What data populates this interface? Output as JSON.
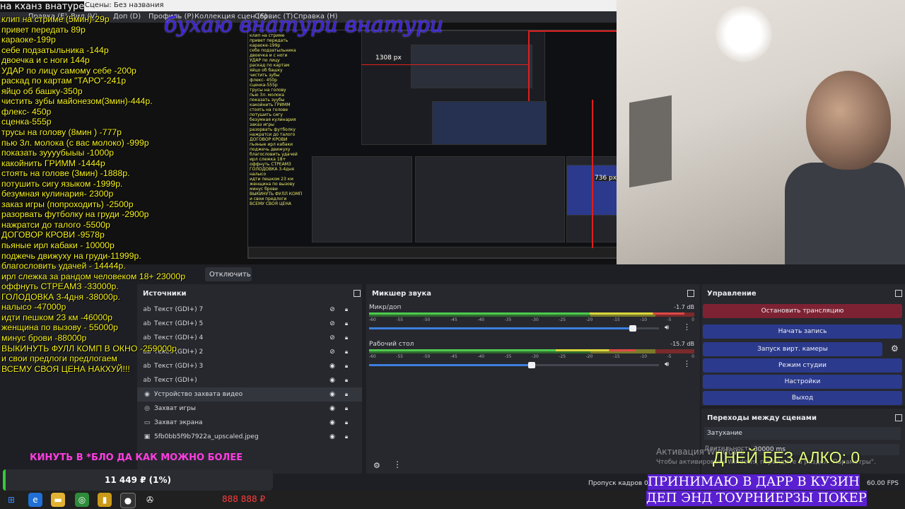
{
  "window": {
    "title": "Сцены: Без названия",
    "caption": "на кханз внатуре"
  },
  "menu": {
    "items": [
      "Правка (E)",
      "Вид (V)",
      "Доп (D)",
      "Профиль (P)",
      "Коллекция сцен (S)",
      "Сервис (T)",
      "Справка (H)"
    ]
  },
  "overlay": {
    "title": "бухаю внатури внатури",
    "donation_goal": "КИНУТЬ В *БЛО ДА КАК МОЖНО БОЛЕЕ",
    "donation_amount": "11 449 ₽ (1%)",
    "money_counter": "888 888 ₽",
    "sober_counter": "ДНЕЙ БЕЗ АЛКО: 0",
    "accept_line1": "ПРИНИМАЮ В ДАРР В КУЗИН",
    "accept_line2": "ДЕП ЭНД ТОУРНИЕРЗЫ ПОКЕР",
    "nested_px_1": "1308 px",
    "nested_px_2": "736 px"
  },
  "price_list": [
    "клип на стриме (5мин)-29р",
    "привет передать 89р",
    "караоке-199р",
    "себе подзатыльника -144р",
    "двоечка и с ноги 144р",
    "УДАР по лицу самому себе -200р",
    "раскад по картам \"ТАРО\"-241р",
    "яйцо об башку-350р",
    "чистить зубы майонезом(3мин)-444р.",
    "флекс- 450р",
    "сценка-555р",
    "трусы на голову (8мин ) -777р",
    "пью 3л. молока (с вас молоко) -999р",
    "показать зуууубыыы -1000р",
    "какойнить ГРИММ -1444р",
    "стоять на голове (3мин) -1888р.",
    "потушить сигу языком -1999р.",
    "безумная кулинария- 2300р",
    "заказ игры (попроходить) -2500р",
    "разорвать футболку на груди -2900р",
    "нажратси до талого -5500р",
    "ДОГОВОР КРОВИ -9578р",
    "пьяные ирл кабаки - 10000р",
    "поджечь движуху на груди-11999р.",
    "благословить удачей - 14444р.",
    "ирл слежка за рандом человеком 18+ 23000р",
    "оффнуть СТРЕАМЗ -33000р.",
    "ГОЛОДОВКА 3-4дня -38000р.",
    "налысо -47000р",
    "идти пешком 23 км -46000р",
    "женщина по вызову - 55000р",
    "минус брови -88000р",
    "ВЫКИНУТЬ ФУЛЛ КОМП В ОКНО -259000р",
    "и свои предлоги предлогаем",
    "ВСЕМУ СВОЯ ЦЕНА НАКХУЙ!!!"
  ],
  "stream": {
    "stop_label": "Отключить"
  },
  "sources": {
    "title": "Источники",
    "items": [
      {
        "icon": "text-icon",
        "glyph": "ab",
        "label": "Текст (GDI+) 7",
        "hidden": true
      },
      {
        "icon": "text-icon",
        "glyph": "ab",
        "label": "Текст (GDI+) 5",
        "hidden": true
      },
      {
        "icon": "text-icon",
        "glyph": "ab",
        "label": "Текст (GDI+) 4",
        "hidden": true
      },
      {
        "icon": "text-icon",
        "glyph": "ab",
        "label": "Текст (GDI+) 2",
        "hidden": true
      },
      {
        "icon": "text-icon",
        "glyph": "ab",
        "label": "Текст (GDI+) 3",
        "hidden": false
      },
      {
        "icon": "text-icon",
        "glyph": "ab",
        "label": "Текст (GDI+)",
        "hidden": false
      },
      {
        "icon": "camera-icon",
        "glyph": "◉",
        "label": "Устройство захвата видео",
        "hidden": false
      },
      {
        "icon": "gamepad-icon",
        "glyph": "◎",
        "label": "Захват игры",
        "hidden": false
      },
      {
        "icon": "monitor-icon",
        "glyph": "▭",
        "label": "Захват экрана",
        "hidden": false
      },
      {
        "icon": "image-icon",
        "glyph": "▣",
        "label": "5fb0bb5f9b7922a_upscaled.jpeg",
        "hidden": false
      }
    ]
  },
  "mixer": {
    "title": "Микшер звука",
    "ticks": [
      "-60",
      "-55",
      "-50",
      "-45",
      "-40",
      "-35",
      "-30",
      "-25",
      "-20",
      "-15",
      "-10",
      "-5",
      "0"
    ],
    "channels": [
      {
        "name": "Микр/доп",
        "db": "-1.7 dB",
        "level": 0.97,
        "volume": 0.91
      },
      {
        "name": "Рабочий стол",
        "db": "-15.7 dB",
        "level": 0.82,
        "volume": 0.56
      }
    ]
  },
  "controls": {
    "title": "Управление",
    "stop_stream": "Остановить трансляцию",
    "start_record": "Начать запись",
    "virtual_cam": "Запуск вирт. камеры",
    "studio_mode": "Режим студии",
    "settings": "Настройки",
    "exit": "Выход"
  },
  "transitions": {
    "title": "Переходы между сценами",
    "selected": "Затухание",
    "duration_label": "Длительность",
    "duration_value": "30000 ms"
  },
  "statusbar": {
    "dropped_frames": "Пропуск кадров 0 (0.0%)",
    "fps": "60.00 FPS"
  },
  "activation": {
    "title": "Активация Windows",
    "subtitle": "Чтобы активировать Windows, перейдите в раздел \"Параметры\"."
  },
  "colors": {
    "accent_blue": "#2b3a8c",
    "stop_red": "#7d2233",
    "price_yellow": "#f7f31f"
  }
}
